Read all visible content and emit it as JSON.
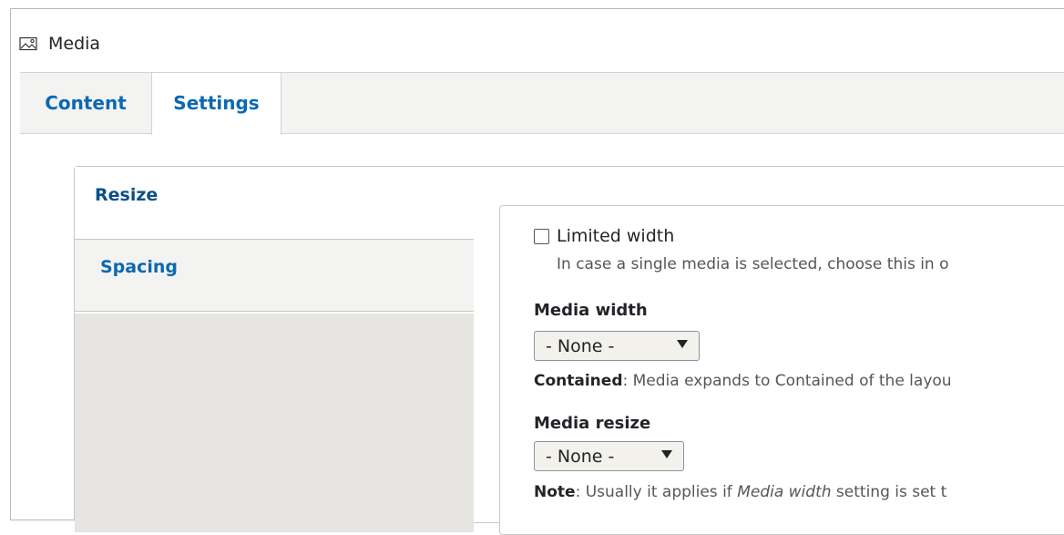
{
  "block": {
    "title": "Media",
    "icon": "image-icon"
  },
  "tabs": [
    {
      "label": "Content",
      "active": false
    },
    {
      "label": "Settings",
      "active": true
    }
  ],
  "vertical_tabs": [
    {
      "label": "Resize",
      "active": true
    },
    {
      "label": "Spacing",
      "active": false
    }
  ],
  "limited_width": {
    "label": "Limited width",
    "checked": false,
    "description": "In case a single media is selected, choose this in o"
  },
  "media_width": {
    "label": "Media width",
    "value": "- None -",
    "help_term": "Contained",
    "help_text": ": Media expands to Contained of the layou"
  },
  "media_resize": {
    "label": "Media resize",
    "value": "- None -",
    "note_term": "Note",
    "note_text_1": ": Usually it applies if ",
    "note_em": "Media width",
    "note_text_2": " setting is set t"
  },
  "colors": {
    "link": "#0b68b3",
    "active_vtab": "#0c4f86",
    "tabbar_bg": "#f3f3f2",
    "vtab_menu_bg": "#e6e5e1"
  }
}
